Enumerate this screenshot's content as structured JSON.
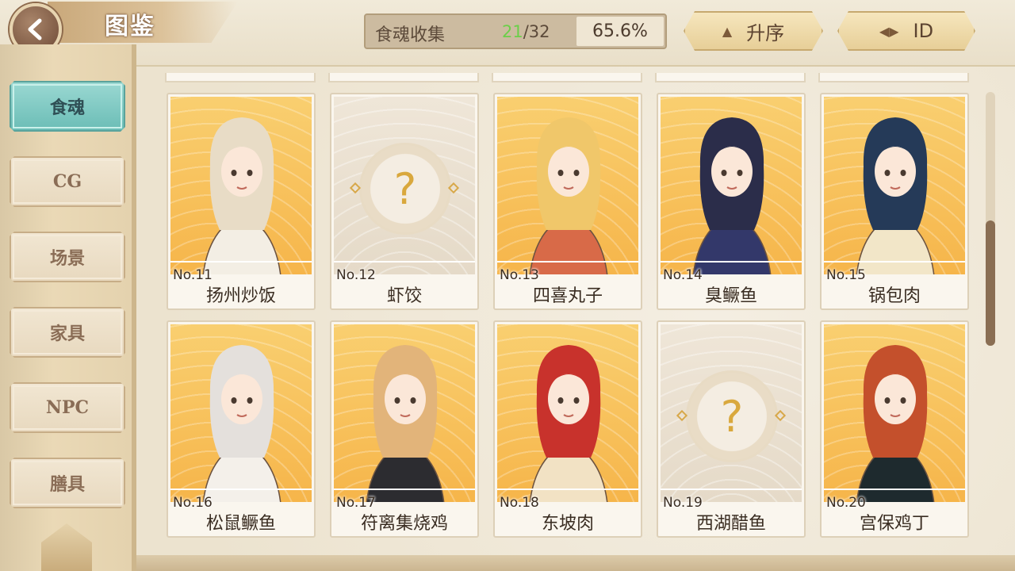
{
  "header": {
    "title": "图鉴",
    "back_icon": "back-arrow-icon",
    "collection": {
      "label": "食魂收集",
      "collected": "21",
      "total": "/32",
      "percent": "65.6%"
    },
    "sort_order": {
      "label": "升序",
      "icon": "triangle-up-icon"
    },
    "sort_key": {
      "label": "ID",
      "icon": "sort-arrows-icon"
    }
  },
  "sidebar": {
    "items": [
      {
        "label": "食魂",
        "active": true
      },
      {
        "label": "CG",
        "active": false
      },
      {
        "label": "场景",
        "active": false
      },
      {
        "label": "家具",
        "active": false
      },
      {
        "label": "NPC",
        "active": false
      },
      {
        "label": "膳具",
        "active": false
      }
    ]
  },
  "cards": [
    {
      "no": "No.11",
      "name": "扬州炒饭",
      "unlocked": true,
      "hair": "#e8dcc6",
      "outfit": "#f3eee4"
    },
    {
      "no": "No.12",
      "name": "虾饺",
      "unlocked": false
    },
    {
      "no": "No.13",
      "name": "四喜丸子",
      "unlocked": true,
      "hair": "#f0c76a",
      "outfit": "#d86a48"
    },
    {
      "no": "No.14",
      "name": "臭鳜鱼",
      "unlocked": true,
      "hair": "#2b2d4a",
      "outfit": "#33386a"
    },
    {
      "no": "No.15",
      "name": "锅包肉",
      "unlocked": true,
      "hair": "#253a58",
      "outfit": "#f2e6c8"
    },
    {
      "no": "No.16",
      "name": "松鼠鳜鱼",
      "unlocked": true,
      "hair": "#e4e0dc",
      "outfit": "#f4f0ea"
    },
    {
      "no": "No.17",
      "name": "符离集烧鸡",
      "unlocked": true,
      "hair": "#e2b47a",
      "outfit": "#2c2c30"
    },
    {
      "no": "No.18",
      "name": "东坡肉",
      "unlocked": true,
      "hair": "#c8322c",
      "outfit": "#f2e2c4"
    },
    {
      "no": "No.19",
      "name": "西湖醋鱼",
      "unlocked": false
    },
    {
      "no": "No.20",
      "name": "宫保鸡丁",
      "unlocked": true,
      "hair": "#c4502c",
      "outfit": "#1e2a2e"
    }
  ],
  "locked_symbol": "?",
  "colors": {
    "accent_teal": "#6bbdb6",
    "collected_green": "#6ccf4a",
    "card_gold": "#f6b54a"
  }
}
